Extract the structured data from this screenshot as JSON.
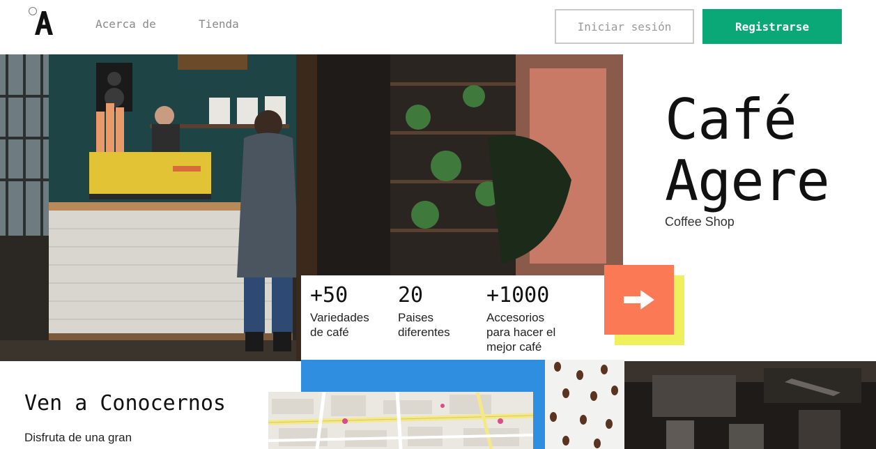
{
  "header": {
    "logo_letter": "A",
    "nav": [
      {
        "label": "Acerca de"
      },
      {
        "label": "Tienda"
      }
    ],
    "login_label": "Iniciar sesión",
    "signup_label": "Registrarse"
  },
  "hero": {
    "title_line1": "Café",
    "title_line2": "Agere",
    "subtitle": "Coffee Shop",
    "photo_icon": "coffee-shop-interior-photo"
  },
  "stats": [
    {
      "value": "+50",
      "label_lines": [
        "Variedades",
        "de café"
      ]
    },
    {
      "value": "20",
      "label_lines": [
        "Paises",
        "diferentes"
      ]
    },
    {
      "value": "+1000",
      "label_lines": [
        "Accesorios",
        "para hacer el",
        "mejor café"
      ]
    }
  ],
  "arrow_button": {
    "icon": "arrow-right-icon"
  },
  "about": {
    "title": "Ven a Conocernos",
    "text": "Disfruta de una gran"
  },
  "colors": {
    "accent_green": "#0aa876",
    "accent_orange": "#fb7a55",
    "accent_yellow": "#eef05c",
    "accent_blue": "#2f8ee0"
  }
}
